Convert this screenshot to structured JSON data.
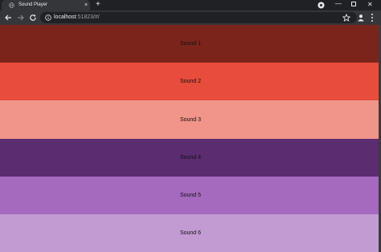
{
  "browser": {
    "tab_title": "Sound Player",
    "new_tab_label": "+",
    "tab_close_label": "×",
    "url_host": "localhost",
    "url_rest": ":51823/#/",
    "window_min": "—",
    "window_close": "✕"
  },
  "sounds": [
    {
      "label": "Sound 1",
      "color": "#7b241c"
    },
    {
      "label": "Sound 2",
      "color": "#e74c3c"
    },
    {
      "label": "Sound 3",
      "color": "#f1948a"
    },
    {
      "label": "Sound 4",
      "color": "#5b2c6f"
    },
    {
      "label": "Sound 5",
      "color": "#a569bd"
    },
    {
      "label": "Sound 6",
      "color": "#c39bd3"
    }
  ]
}
